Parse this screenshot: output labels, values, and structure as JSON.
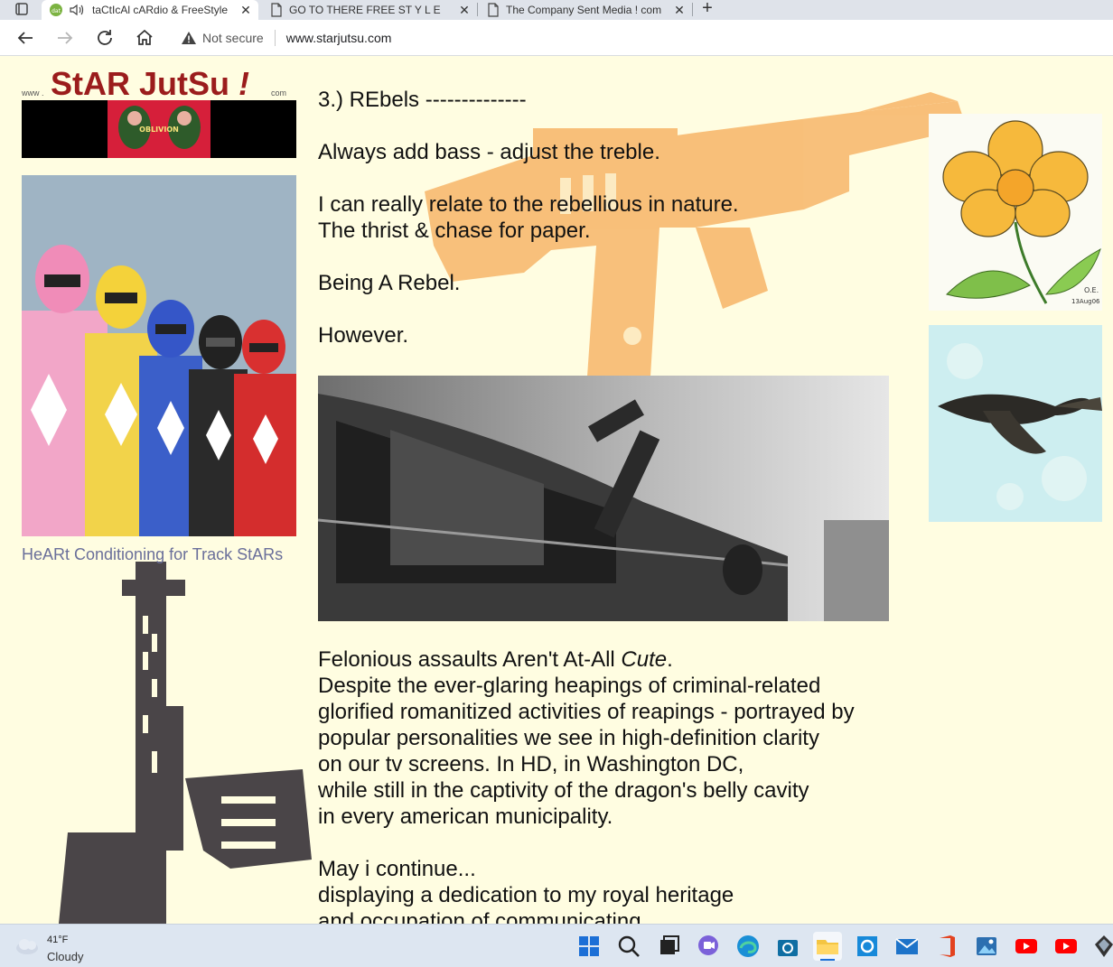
{
  "browser": {
    "tabs": [
      {
        "title": "taCtIcAl cARdio & FreeStyle",
        "active": true
      },
      {
        "title": "GO TO THERE FREE ST Y L E",
        "active": false
      },
      {
        "title": "The Company Sent Media ! com",
        "active": false
      }
    ],
    "not_secure": "Not secure",
    "url": "www.starjutsu.com"
  },
  "site": {
    "logo_prefix": "www .",
    "logo_name": "StAR JutSu",
    "logo_bang": "!",
    "logo_suffix": "com",
    "banner_text": "OBLIVION",
    "side_link": "HeARt Conditioning for Track StARs"
  },
  "article": {
    "heading": "3.) REbels --------------",
    "p1": "Always add bass - adjust the treble.",
    "p2_l1": "I can really relate to the rebellious in nature.",
    "p2_l2": "The thrist & chase for paper.",
    "p3": "Being A Rebel.",
    "p4": "However.",
    "p5_l1_a": "Felonious assaults Aren't At-All ",
    "p5_l1_b": "Cute",
    "p5_l1_c": ".",
    "p5_l2": "Despite the ever-glaring heapings of criminal-related",
    "p5_l3": "glorified romanitized activities of reapings - portrayed by",
    "p5_l4": "popular personalities we see in high-definition clarity",
    "p5_l5": "on our tv screens. In HD, in Washington DC,",
    "p5_l6": "while still in the captivity of the dragon's belly cavity",
    "p5_l7": "in every american municipality.",
    "p6_l1": "May i continue...",
    "p6_l2": "displaying a dedication to my royal heritage",
    "p6_l3": "and occupation of communicating"
  },
  "artwork": {
    "signature": "O.E.",
    "date": "13Aug06"
  },
  "taskbar": {
    "temperature": "41°F",
    "condition": "Cloudy",
    "icons": [
      "windows-start-icon",
      "search-icon",
      "task-view-icon",
      "chat-icon",
      "edge-icon",
      "store-icon",
      "file-explorer-icon",
      "cortana-icon",
      "mail-icon",
      "office-icon",
      "photos-icon",
      "youtube-icon",
      "youtube-icon-2",
      "app-icon"
    ]
  },
  "colors": {
    "page_bg": "#fffde1",
    "logo_red": "#9b1c1c",
    "link_color": "#6a6f9a",
    "rifle_orange": "#f4a04a"
  }
}
